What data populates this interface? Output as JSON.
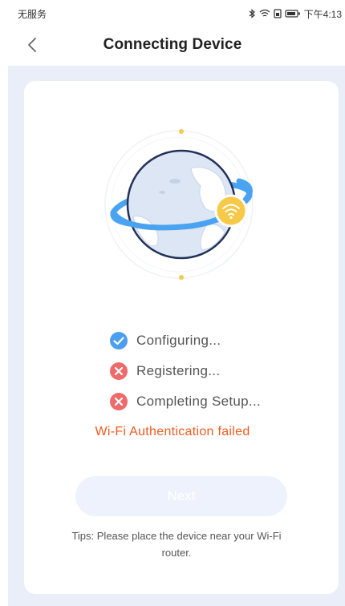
{
  "status_bar": {
    "carrier": "无服务",
    "time": "下午4:13",
    "icons": [
      "bluetooth-icon",
      "wifi-icon",
      "sim-icon",
      "battery-icon"
    ]
  },
  "nav": {
    "title": "Connecting Device",
    "back_icon": "chevron-left-icon"
  },
  "steps": [
    {
      "label": "Configuring...",
      "status": "success"
    },
    {
      "label": "Registering...",
      "status": "failed"
    },
    {
      "label": "Completing Setup...",
      "status": "failed"
    }
  ],
  "error_message": "Wi-Fi Authentication failed",
  "next_button": {
    "label": "Next",
    "enabled": false
  },
  "tips": "Tips: Please place the device near your Wi-Fi router.",
  "colors": {
    "success": "#4a9ff0",
    "failed": "#ef6b6b",
    "error_text": "#f25a1e",
    "page_bg": "#e9eef9",
    "globe": "#dce6f4",
    "orbit": "#4aa3f0",
    "wifi_badge": "#f7c948"
  }
}
